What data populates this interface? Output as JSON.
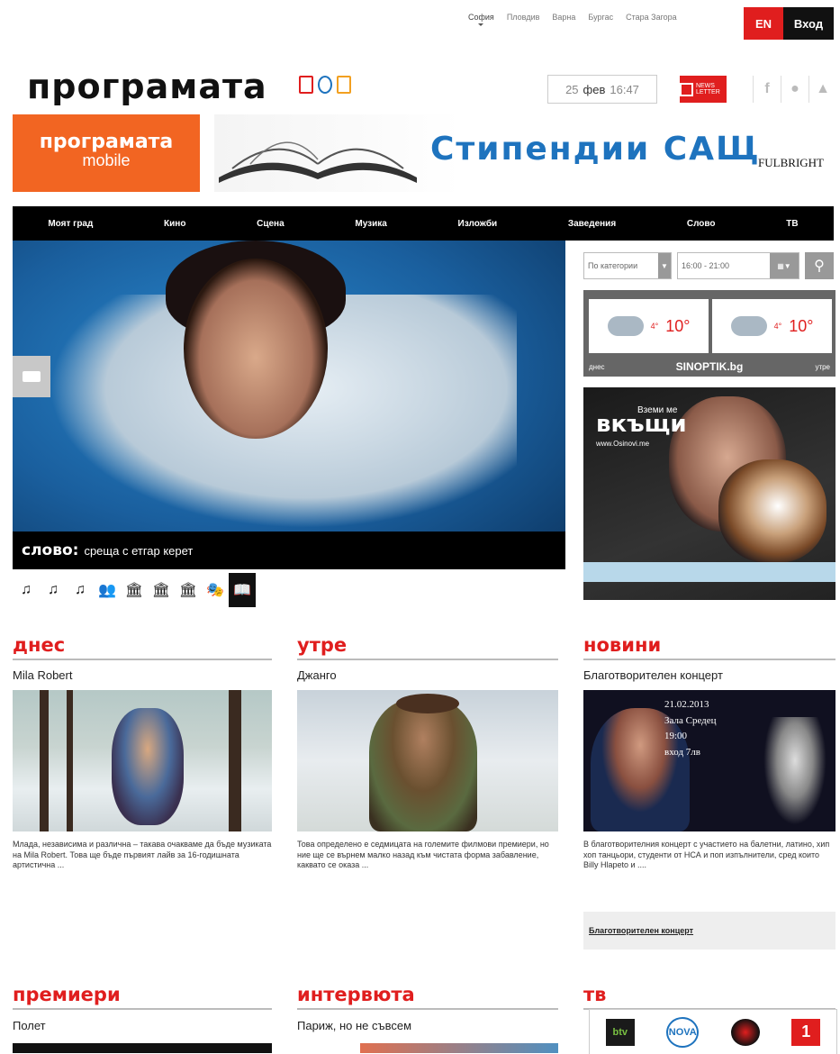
{
  "cities": [
    "София",
    "Пловдив",
    "Варна",
    "Бургас",
    "Стара Загора"
  ],
  "top_buttons": {
    "en": "EN",
    "login": "Вход"
  },
  "logo": {
    "text": "програмата"
  },
  "date": {
    "day": "25",
    "month": "фев",
    "time": "16:47"
  },
  "newsletter": {
    "label": "NEWS LETTER"
  },
  "social": [
    "f",
    "",
    ""
  ],
  "banners": {
    "mobile_l1": "програмата",
    "mobile_l2": "mobile",
    "fulbright_text": "Стипендии   САЩ",
    "fulbright_logo": "FULBRIGHT"
  },
  "nav": [
    "Моят град",
    "Кино",
    "Сцена",
    "Музика",
    "Изложби",
    "Заведения",
    "Слово",
    "ТВ"
  ],
  "hero": {
    "category": "слово:",
    "caption": "среща с етгар керет"
  },
  "hero_icons": [
    "♫",
    "♫",
    "♫",
    "👥",
    "🏛",
    "🏛",
    "🏛",
    "🎭",
    "📖"
  ],
  "filter": {
    "category": "По категории",
    "time": "16:00 - 21:00"
  },
  "weather": {
    "today_temp": "10°",
    "today_prefix": "4°",
    "tomorrow_temp": "10°",
    "tomorrow_prefix": "4°",
    "today_label": "днес",
    "tomorrow_label": "утре",
    "source": "SINOPTIK.bg"
  },
  "ad": {
    "line0": "Вземи ме",
    "line1": "вкъщи",
    "line2": "www.Osinovi.me"
  },
  "sections": {
    "today": {
      "title": "днес",
      "item": "Mila Robert",
      "text": "Млада, независима и различна – такава очакваме да бъде музиката на Mila Robert. Това ще бъде първият лайв за 16-годишната артистична ..."
    },
    "tomorrow": {
      "title": "утре",
      "item": "Джанго",
      "text": "Това определено е седмицата на големите филмови премиери, но ние ще се върнем малко назад към чистата форма забавление, каквато се оказа ..."
    },
    "news": {
      "title": "новини",
      "item": "Благотворителен концерт",
      "text": "В благотворителния концерт с участието на балетни, латино, хип хоп танцьори, студенти от НСА и поп изпълнители, сред които Billy Hlapeto и ....",
      "photo_text": [
        "21.02.2013",
        "Зала Средец",
        "19:00",
        "вход 7лв"
      ],
      "link": "Благотворителен концерт"
    },
    "premieres": {
      "title": "премиери",
      "item": "Полет"
    },
    "interviews": {
      "title": "интервюта",
      "item": "Париж, но не съвсем"
    },
    "tv": {
      "title": "тв",
      "channels": [
        "btv",
        "NOVA",
        "",
        "1"
      ]
    }
  }
}
